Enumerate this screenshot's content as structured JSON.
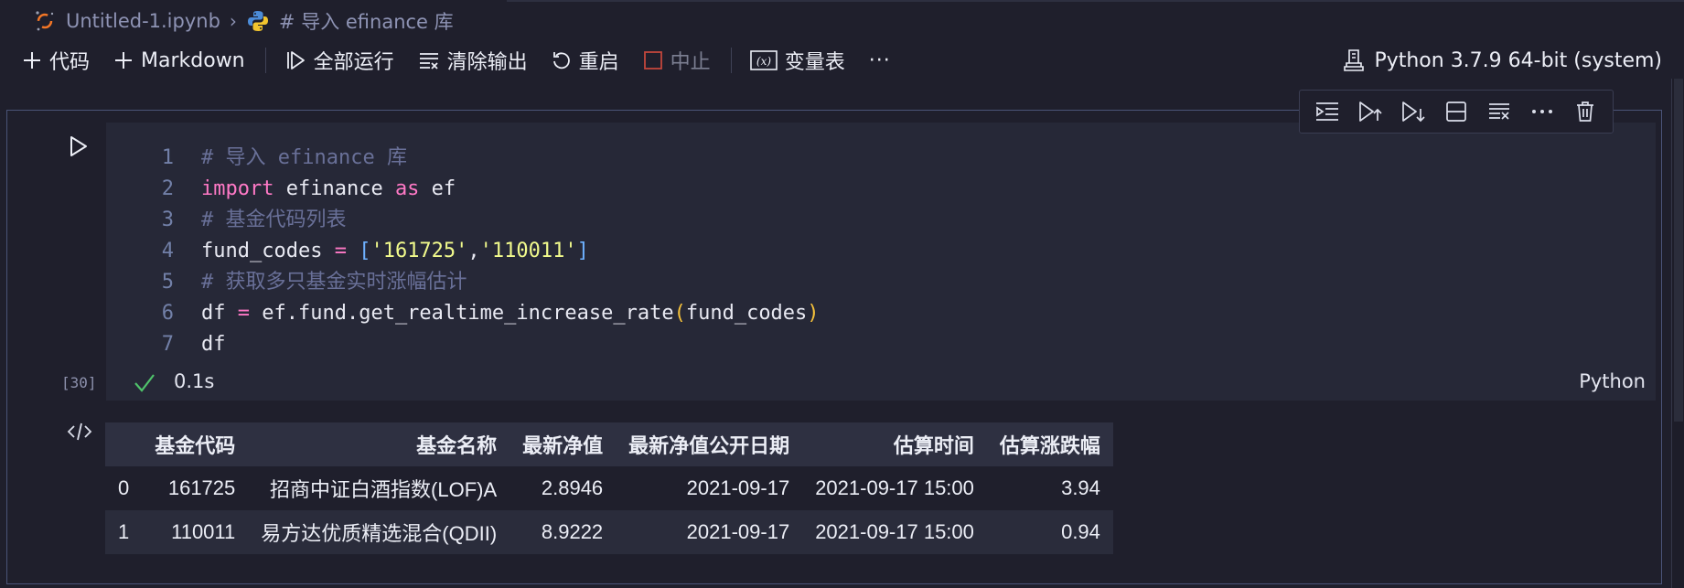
{
  "breadcrumb": {
    "file": "Untitled-1.ipynb",
    "cell": "# 导入 efinance 库"
  },
  "toolbar": {
    "code_label": "代码",
    "markdown_label": "Markdown",
    "run_all_label": "全部运行",
    "clear_label": "清除输出",
    "restart_label": "重启",
    "stop_label": "中止",
    "variables_label": "变量表",
    "more_label": "···"
  },
  "kernel": {
    "label": "Python 3.7.9 64-bit (system)"
  },
  "cell": {
    "line_numbers": [
      "1",
      "2",
      "3",
      "4",
      "5",
      "6",
      "7"
    ],
    "execution_count": "[30]",
    "duration": "0.1s",
    "language": "Python"
  },
  "output": {
    "columns": [
      "",
      "基金代码",
      "基金名称",
      "最新净值",
      "最新净值公开日期",
      "估算时间",
      "估算涨跌幅"
    ],
    "rows": [
      [
        "0",
        "161725",
        "招商中证白酒指数(LOF)A",
        "2.8946",
        "2021-09-17",
        "2021-09-17 15:00",
        "3.94"
      ],
      [
        "1",
        "110011",
        "易方达优质精选混合(QDII)",
        "8.9222",
        "2021-09-17",
        "2021-09-17 15:00",
        "0.94"
      ]
    ]
  },
  "colors": {
    "background": "#1f1f2c",
    "editor_background": "#262837",
    "keyword": "#ff79c6",
    "string": "#f1fa8c",
    "comment": "#697098",
    "success": "#4fc36b"
  },
  "icons": [
    "jupyter-icon",
    "python-icon",
    "plus-icon",
    "run-all-icon",
    "clear-output-icon",
    "restart-icon",
    "stop-icon",
    "variables-icon",
    "kernel-icon",
    "run-cell-icon",
    "check-icon",
    "output-icon",
    "trash-icon"
  ]
}
